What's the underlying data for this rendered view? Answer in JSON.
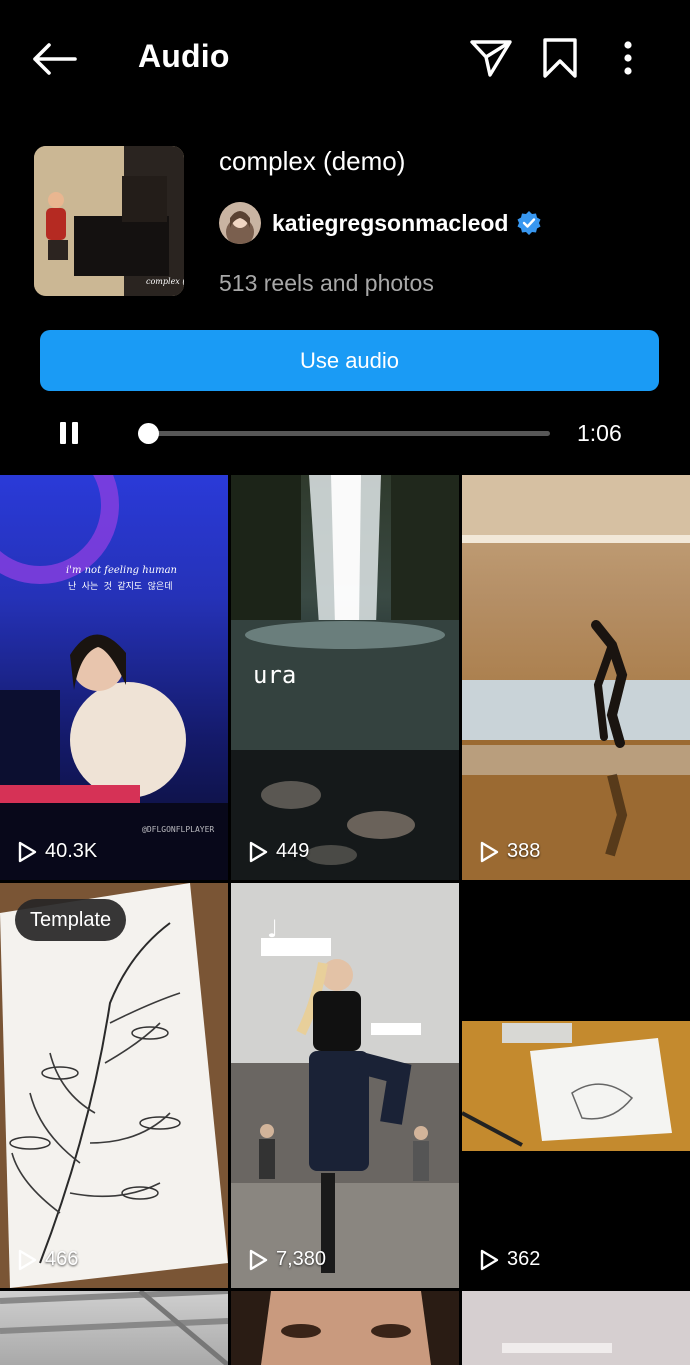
{
  "header": {
    "title": "Audio",
    "back_icon": "arrow-left-icon",
    "share_icon": "paper-plane-icon",
    "save_icon": "bookmark-icon",
    "more_icon": "more-vertical-icon"
  },
  "audio": {
    "track_title": "complex (demo)",
    "artist_name": "katiegregsonmacleod",
    "verified": true,
    "reel_count": "513 reels and photos",
    "album_caption": "complex (demo)",
    "use_audio_label": "Use audio",
    "playback_state": "playing",
    "playback_progress": 0.0,
    "time_label": "1:06"
  },
  "colors": {
    "background": "#000000",
    "accent_blue": "#1a9bf5",
    "secondary_text": "#a8a8a8",
    "verified_badge": "#3897f0"
  },
  "reels": [
    {
      "views": "40.3K",
      "caption": "i'm not feeling human",
      "caption_sub": "난 사는 것 같지도 않은데",
      "watermark": "@DFLGONFLPLAYER"
    },
    {
      "views": "449",
      "caption": "ura"
    },
    {
      "views": "388"
    },
    {
      "views": "466",
      "badge": "Template"
    },
    {
      "views": "7,380"
    },
    {
      "views": "362"
    },
    {
      "views": ""
    },
    {
      "views": ""
    },
    {
      "views": ""
    }
  ]
}
